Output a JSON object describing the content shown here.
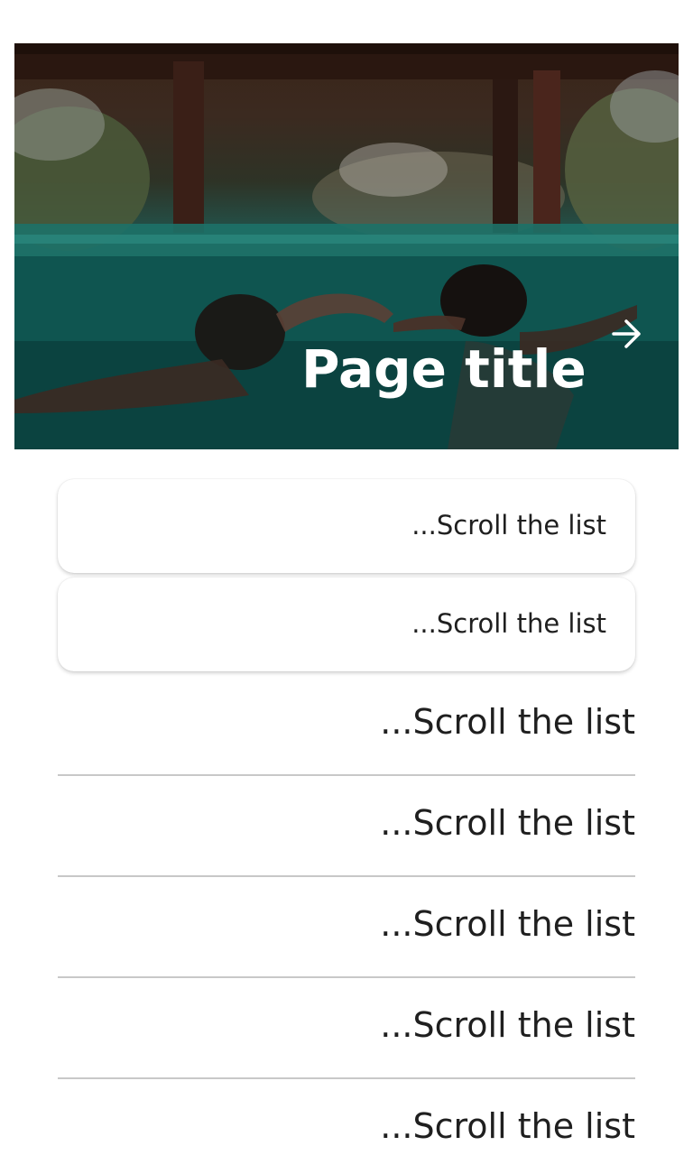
{
  "hero": {
    "title": "Page title",
    "next_icon": "arrow-right-icon"
  },
  "list": {
    "cards": [
      {
        "label": "...Scroll the list"
      },
      {
        "label": "...Scroll the list"
      }
    ],
    "rows": [
      {
        "label": "...Scroll the list"
      },
      {
        "label": "...Scroll the list"
      },
      {
        "label": "...Scroll the list"
      },
      {
        "label": "...Scroll the list"
      },
      {
        "label": "...Scroll the list"
      }
    ]
  }
}
